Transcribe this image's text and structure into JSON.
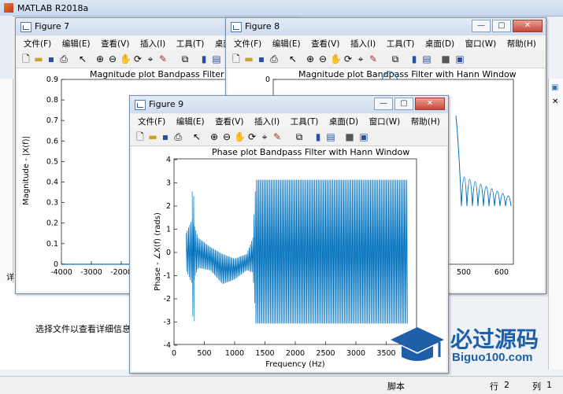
{
  "app": {
    "title": "MATLAB R2018a"
  },
  "detail_panel": {
    "hint": "选择文件以查看详细信息",
    "tab": "详"
  },
  "statusbar": {
    "script_label": "脚本",
    "row_label": "行",
    "row_value": "2",
    "col_label": "列",
    "col_value": "1"
  },
  "menu": [
    "文件(F)",
    "编辑(E)",
    "查看(V)",
    "插入(I)",
    "工具(T)",
    "桌面(D)",
    "窗口(W)",
    "帮助(H)"
  ],
  "fig7": {
    "title": "Figure 7",
    "plot_title": "Magnitude plot Bandpass Filter with H",
    "ylabel": "Magnitude - |X(f)|",
    "yticks": [
      "0.9",
      "0.8",
      "0.7",
      "0.6",
      "0.5",
      "0.4",
      "0.3",
      "0.2",
      "0.1",
      "0"
    ],
    "xticks": [
      "-4000",
      "-3000",
      "-2000"
    ]
  },
  "fig8": {
    "title": "Figure 8",
    "plot_title": "Magnitude plot Bandpass Filter with Hann Window",
    "yticks": [
      "0"
    ],
    "xticks": [
      "500",
      "600"
    ]
  },
  "fig9": {
    "title": "Figure 9",
    "plot_title": "Phase plot Bandpass Filter with Hann Window",
    "ylabel": "Phase - ∠X(f) (rads)",
    "xlabel": "Frequency (Hz)",
    "yticks": [
      "4",
      "3",
      "2",
      "1",
      "0",
      "-1",
      "-2",
      "-3",
      "-4"
    ],
    "xticks": [
      "0",
      "500",
      "1000",
      "1500",
      "2000",
      "2500",
      "3000",
      "3500"
    ]
  },
  "watermark": {
    "cn": "必过源码",
    "url": "Biguo100.com"
  },
  "colors": {
    "plot_line": "#0072bd",
    "title_bar": "#dbe6f4"
  },
  "chart_data": [
    {
      "type": "line",
      "title": "Phase plot Bandpass Filter with Hann Window",
      "xlabel": "Frequency (Hz)",
      "ylabel": "Phase - ∠X(f) (rads)",
      "xlim": [
        0,
        4000
      ],
      "ylim": [
        -4,
        4
      ],
      "series": [
        {
          "x": [
            200,
            300,
            400,
            600,
            800,
            1000,
            1200,
            1300,
            1350,
            1500,
            2000,
            2500,
            3000,
            3500,
            3850
          ],
          "y_upper": [
            0.8,
            1.4,
            0.6,
            0.2,
            -0.1,
            -0.3,
            -0.1,
            0.6,
            3.1,
            3.1,
            3.1,
            3.1,
            3.1,
            3.1,
            3.1
          ],
          "y_lower": [
            -0.8,
            -1.4,
            -0.7,
            -0.8,
            -1.4,
            -1.2,
            -0.8,
            -0.9,
            -3.1,
            -3.1,
            -3.1,
            -3.1,
            -3.1,
            -3.1,
            -3.1
          ]
        }
      ]
    }
  ]
}
